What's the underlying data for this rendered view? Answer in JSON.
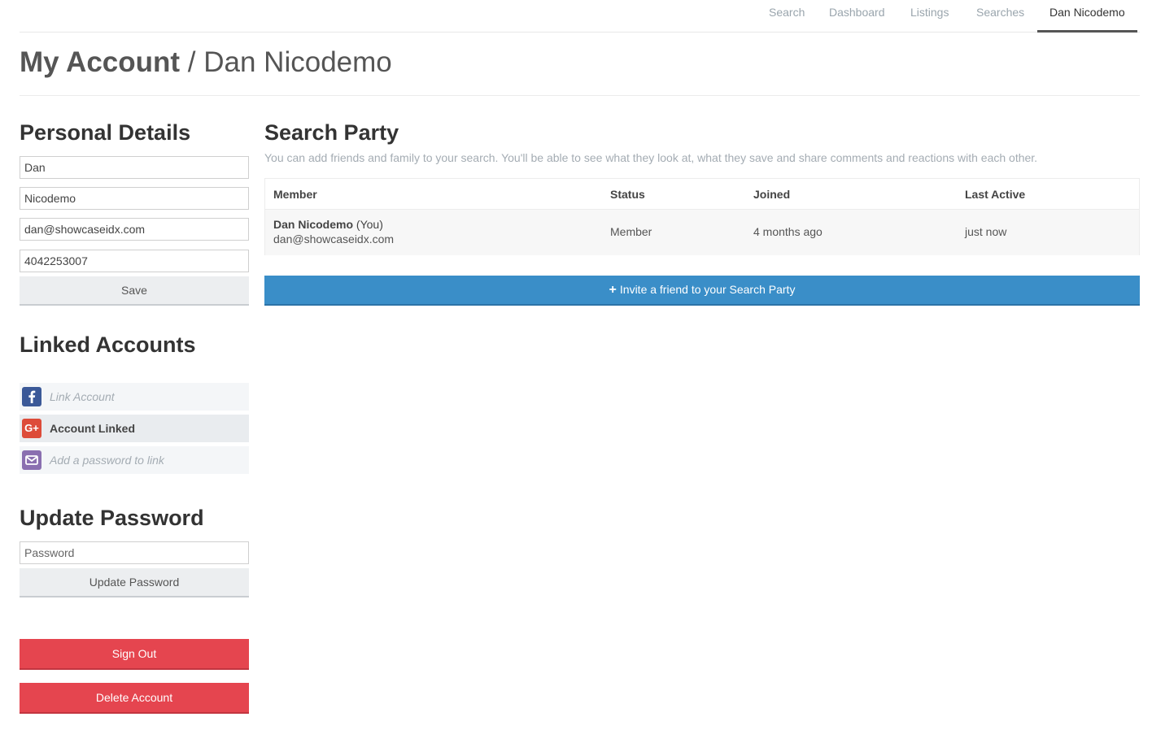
{
  "nav": {
    "items": [
      "Search",
      "Dashboard",
      "Listings",
      "Searches",
      "Dan Nicodemo"
    ],
    "active": "Dan Nicodemo"
  },
  "header": {
    "title_strong": "My Account",
    "separator": "/",
    "title_name": "Dan Nicodemo"
  },
  "personal_details": {
    "heading": "Personal Details",
    "first_name": "Dan",
    "last_name": "Nicodemo",
    "email": "dan@showcaseidx.com",
    "phone": "4042253007",
    "save_label": "Save"
  },
  "linked_accounts": {
    "heading": "Linked Accounts",
    "facebook": {
      "icon": "facebook-icon",
      "label": "Link Account",
      "color": "#3b5998"
    },
    "google": {
      "icon": "google-plus-icon",
      "label": "Account Linked",
      "color": "#dd4b39"
    },
    "email": {
      "icon": "envelope-icon",
      "label": "Add a password to link",
      "color": "#8a6fb0"
    }
  },
  "update_password": {
    "heading": "Update Password",
    "password_placeholder": "Password",
    "button_label": "Update Password"
  },
  "account_actions": {
    "sign_out_label": "Sign Out",
    "delete_label": "Delete Account",
    "color": "#e5454f"
  },
  "search_party": {
    "heading": "Search Party",
    "description": "You can add friends and family to your search. You'll be able to see what they look at, what they save and share comments and reactions with each other.",
    "columns": [
      "Member",
      "Status",
      "Joined",
      "Last Active"
    ],
    "rows": [
      {
        "name": "Dan Nicodemo",
        "you_label": "(You)",
        "email": "dan@showcaseidx.com",
        "status": "Member",
        "joined": "4 months ago",
        "last_active": "just now"
      }
    ],
    "invite_label": "Invite a friend to your Search Party",
    "invite_color": "#3a8ec8"
  }
}
